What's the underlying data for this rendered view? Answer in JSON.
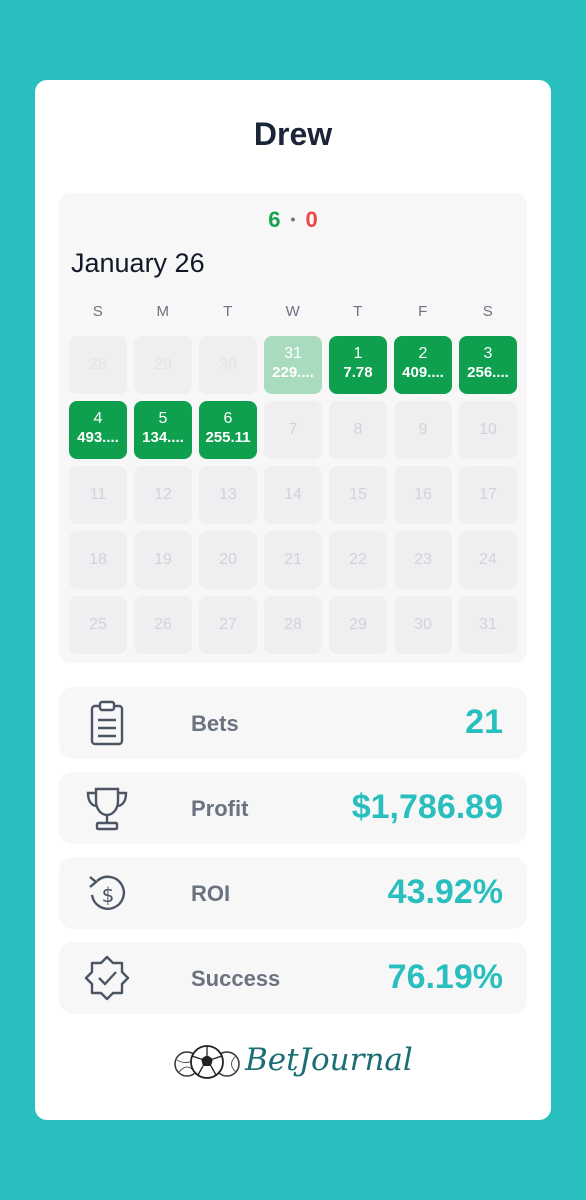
{
  "user": {
    "name": "Drew"
  },
  "record": {
    "wins": "6",
    "separator": "•",
    "losses": "0"
  },
  "calendar": {
    "month_label": "January 26",
    "weekdays": [
      "S",
      "M",
      "T",
      "W",
      "T",
      "F",
      "S"
    ],
    "prev_month_days": [
      {
        "day": "28"
      },
      {
        "day": "29"
      },
      {
        "day": "30"
      },
      {
        "day": "31",
        "value": "229....",
        "status": "win"
      }
    ],
    "days": [
      {
        "day": "1",
        "value": "7.78",
        "status": "win"
      },
      {
        "day": "2",
        "value": "409....",
        "status": "win"
      },
      {
        "day": "3",
        "value": "256....",
        "status": "win"
      },
      {
        "day": "4",
        "value": "493....",
        "status": "win"
      },
      {
        "day": "5",
        "value": "134....",
        "status": "win"
      },
      {
        "day": "6",
        "value": "255.11",
        "status": "win"
      },
      {
        "day": "7"
      },
      {
        "day": "8"
      },
      {
        "day": "9"
      },
      {
        "day": "10"
      },
      {
        "day": "11"
      },
      {
        "day": "12"
      },
      {
        "day": "13"
      },
      {
        "day": "14"
      },
      {
        "day": "15"
      },
      {
        "day": "16"
      },
      {
        "day": "17"
      },
      {
        "day": "18"
      },
      {
        "day": "19"
      },
      {
        "day": "20"
      },
      {
        "day": "21"
      },
      {
        "day": "22"
      },
      {
        "day": "23"
      },
      {
        "day": "24"
      },
      {
        "day": "25"
      },
      {
        "day": "26"
      },
      {
        "day": "27"
      },
      {
        "day": "28"
      },
      {
        "day": "29"
      },
      {
        "day": "30"
      },
      {
        "day": "31"
      }
    ],
    "win_color": "#0E9F4F"
  },
  "stats": {
    "bets": {
      "label": "Bets",
      "value": "21",
      "icon": "clipboard-icon"
    },
    "profit": {
      "label": "Profit",
      "value": "$1,786.89",
      "icon": "trophy-icon"
    },
    "roi": {
      "label": "ROI",
      "value": "43.92%",
      "icon": "dollar-cycle-icon"
    },
    "success": {
      "label": "Success",
      "value": "76.19%",
      "icon": "verified-badge-icon"
    }
  },
  "brand": {
    "name": "BetJournal",
    "logo_icon": "sports-balls-icon"
  },
  "colors": {
    "accent": "#2ABFBF",
    "win": "#16A34A",
    "loss": "#EF4444"
  }
}
